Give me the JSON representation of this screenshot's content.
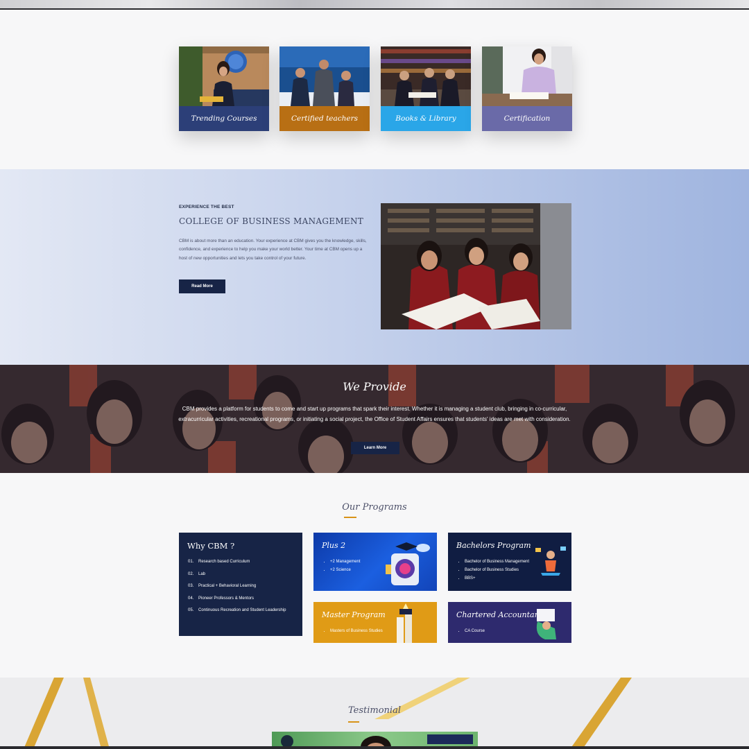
{
  "feature_cards": [
    {
      "label": "Trending Courses",
      "color": "#2c3f78"
    },
    {
      "label": "Certified teachers",
      "color": "#b86f14"
    },
    {
      "label": "Books & Library",
      "color": "#2aa6e8"
    },
    {
      "label": "Certification",
      "color": "#6a6aa8"
    }
  ],
  "about": {
    "eyebrow": "EXPERIENCE THE BEST",
    "title": "COLLEGE OF BUSINESS MANAGEMENT",
    "text": "CBM is about more than an education. Your experience at CBM gives you the knowledge, skills, confidence, and experience to help you make your world better. Your time at CBM opens up a host of new opportunities and lets you take control of your future.",
    "button": "Read More"
  },
  "provide": {
    "title": "We Provide",
    "text": "CBM provides a platform for students to come and start up programs that spark their interest. Whether it is managing a student club, bringing in co-curricular, extracurricular activities, recreational programs, or initiating a social project, the Office of Student Affairs ensures that students' ideas are met with consideration.",
    "button": "Learn More"
  },
  "programs": {
    "title": "Our Programs",
    "why": {
      "title": "Why CBM ?",
      "items": [
        {
          "num": "01.",
          "text": "Research based Curriculum"
        },
        {
          "num": "02.",
          "text": "Lab"
        },
        {
          "num": "03.",
          "text": "Practical + Behavioral Learning"
        },
        {
          "num": "04.",
          "text": "Pioneer Professors & Mentors"
        },
        {
          "num": "05.",
          "text": "Continuous Recreation and Student Leadership"
        }
      ]
    },
    "plus2": {
      "title": "Plus 2",
      "items": [
        "+2 Management",
        "+2 Science"
      ]
    },
    "bachelors": {
      "title": "Bachelors Program",
      "items": [
        "Bachelor of Business Management",
        "Bachelor of Business Studies",
        "BBS+"
      ]
    },
    "master": {
      "title": "Master Program",
      "items": [
        "Masters of Business Studies"
      ]
    },
    "ca": {
      "title": "Chartered Accountancy",
      "items": [
        "CA Course"
      ]
    }
  },
  "testimonial": {
    "title": "Testimonial"
  },
  "colors": {
    "navy": "#172446",
    "accent": "#d89318"
  }
}
